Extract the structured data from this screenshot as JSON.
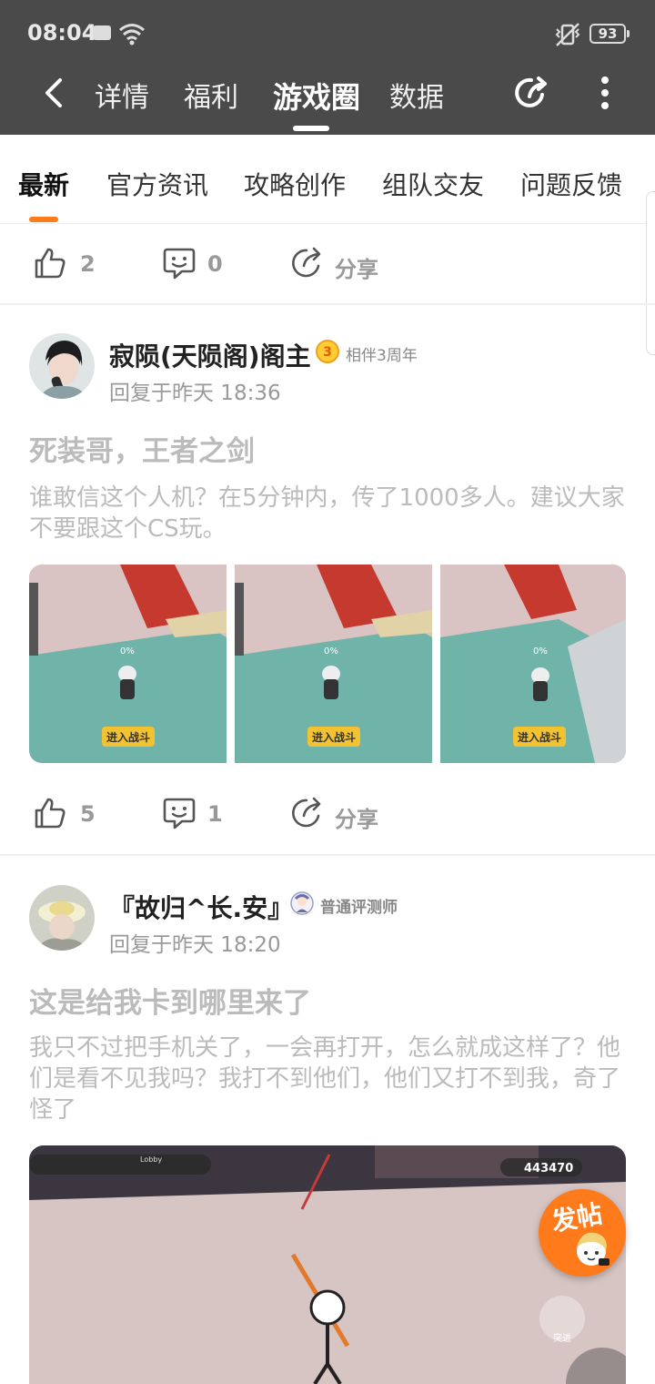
{
  "status_bar": {
    "time": "08:04",
    "battery": "93"
  },
  "nav": {
    "tabs": [
      "详情",
      "福利",
      "游戏圈",
      "数据"
    ],
    "active_tab": "游戏圈"
  },
  "subtabs": [
    "最新",
    "官方资讯",
    "攻略创作",
    "组队交友",
    "问题反馈"
  ],
  "top_actions": {
    "likes": "2",
    "comments": "0",
    "share_label": "分享"
  },
  "posts": [
    {
      "username": "寂陨(天陨阁)阁主",
      "badge": "相伴3周年",
      "badge_icon_text": "3",
      "reply_time": "回复于昨天 18:36",
      "title": "死装哥，王者之剑",
      "body": "谁敢信这个人机？在5分钟内，传了1000多人。建议大家不要跟这个CS玩。",
      "image_caption": "0%",
      "image_button": "进入战斗",
      "likes": "5",
      "comments": "1",
      "share_label": "分享"
    },
    {
      "username": "『故归^长.安』",
      "badge": "普通评测师",
      "reply_time": "回复于昨天 18:20",
      "title": "这是给我卡到哪里来了",
      "body": "我只不过把手机关了，一会再打开，怎么就成这样了？他们是看不见我吗？我打不到他们，他们又打不到我，奇了怪了",
      "image_score": "443470",
      "image_lobby": "Lobby",
      "image_dash": "突进"
    }
  ],
  "fab_label": "发帖",
  "colors": {
    "accent": "#ff7a1a",
    "topbar": "#4a4a4a"
  }
}
